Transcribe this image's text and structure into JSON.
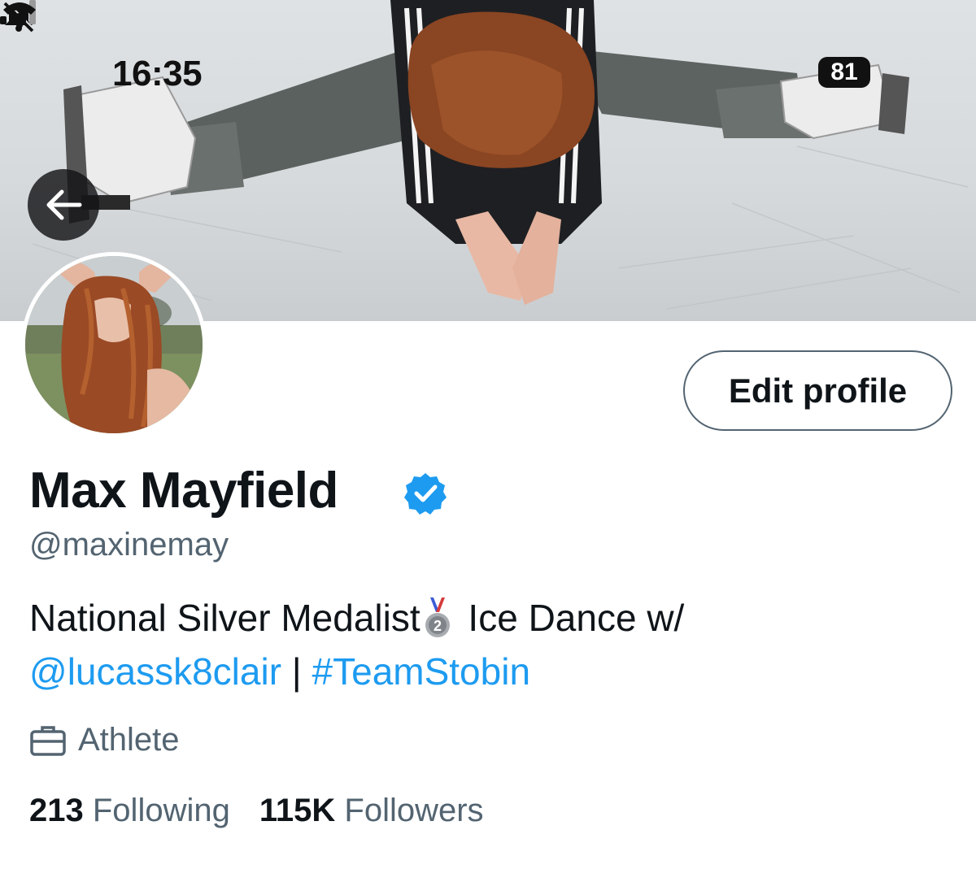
{
  "status_bar": {
    "time": "16:35",
    "battery": "81",
    "icons": [
      "bell-slash-icon",
      "signal-icon",
      "wifi-icon",
      "battery-icon"
    ]
  },
  "nav": {
    "back_icon": "arrow-left-icon"
  },
  "profile": {
    "display_name": "Max Mayfield",
    "verified": true,
    "verified_color": "#1d9bf0",
    "handle": "@maxinemay",
    "edit_button": "Edit profile",
    "bio": {
      "line1_text": "National Silver Medalist",
      "medal_icon": "silver-medal-icon",
      "line1_rest": " Ice Dance w/",
      "mention": "@lucassk8clair",
      "separator": " | ",
      "hashtag": "#TeamStobin"
    },
    "category_icon": "briefcase-icon",
    "category": "Athlete",
    "following_count": "213",
    "following_label": "Following",
    "followers_count": "115K",
    "followers_label": "Followers"
  },
  "colors": {
    "link": "#1d9bf0",
    "secondary_text": "#536471",
    "primary_text": "#0f1419"
  }
}
